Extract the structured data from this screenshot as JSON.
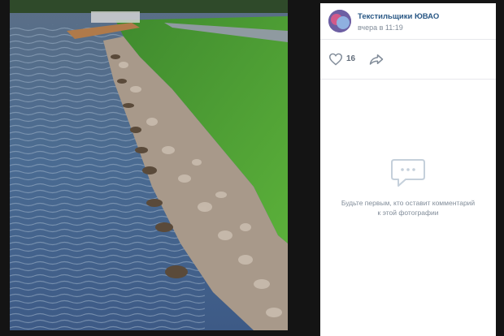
{
  "post": {
    "author": "Текстильщики ЮВАО",
    "date": "вчера в 11:19"
  },
  "actions": {
    "like_count": "16"
  },
  "comments": {
    "empty_text": "Будьте первым, кто оставит комментарий к этой фотографии"
  },
  "photo": {
    "subject": "ducks lined up along stone embankment by the water, green grass slope"
  },
  "colors": {
    "author_link": "#2a5885",
    "muted_text": "#818c99",
    "overlay_bg": "#141414"
  }
}
